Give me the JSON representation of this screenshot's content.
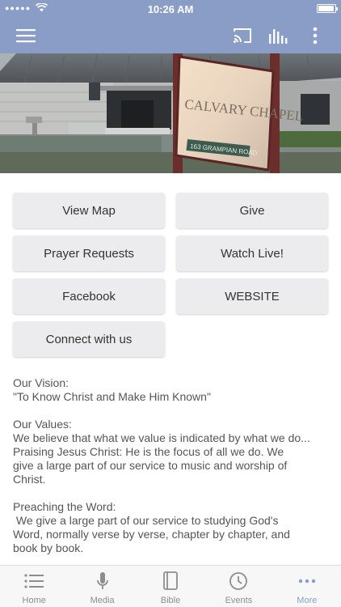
{
  "status": {
    "time": "10:26 AM",
    "battery_level": 0.95
  },
  "colors": {
    "accent": "#8a9dc7",
    "button_bg": "#ececee",
    "inactive_tab": "#8e8e8e"
  },
  "nav": {
    "icons": [
      "menu-icon",
      "cast-icon",
      "audio-bars-icon",
      "more-vertical-icon"
    ]
  },
  "hero": {
    "sign_line1": "CALVARY CHAPEL",
    "sign_address": "163 GRAMPIAN ROAD"
  },
  "buttons": {
    "view_map": "View Map",
    "give": "Give",
    "prayer_requests": "Prayer Requests",
    "watch_live": "Watch Live!",
    "facebook": "Facebook",
    "website": "WEBSITE",
    "connect": "Connect with us"
  },
  "content": {
    "vision_heading": "Our Vision:",
    "vision_text": "\"To Know Christ and Make Him Known\"",
    "values_heading": "Our Values:",
    "values_line1": "We believe that what we value is indicated by what we do...",
    "values_line2": "Praising Jesus Christ:  He is the focus of all we do.  We",
    "values_line3": "give a large part of our service to music and worship of",
    "values_line4": "Christ.",
    "preaching_heading": "Preaching the Word:",
    "preaching_line1": " We give a large part of our service to studying God's",
    "preaching_line2": "Word, normally verse by verse, chapter by chapter, and",
    "preaching_line3": "book by book."
  },
  "tabs": [
    {
      "label": "Home",
      "icon": "list-icon"
    },
    {
      "label": "Media",
      "icon": "microphone-icon"
    },
    {
      "label": "Bible",
      "icon": "book-icon"
    },
    {
      "label": "Events",
      "icon": "clock-icon"
    },
    {
      "label": "More",
      "icon": "more-horizontal-icon"
    }
  ]
}
